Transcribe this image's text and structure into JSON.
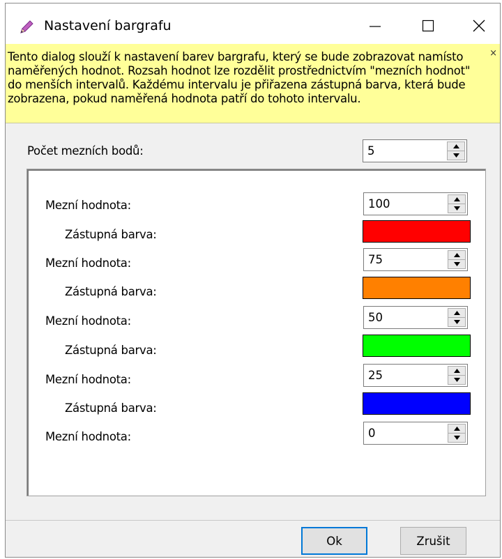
{
  "window": {
    "title": "Nastavení bargrafu",
    "icon": "pencil-icon",
    "controls": {
      "minimize": "—",
      "maximize": "☐",
      "close": "✕"
    }
  },
  "info": {
    "lines": [
      "Tento dialog slouží k nastavení barev bargrafu, který se bude zobrazovat namísto",
      "naměřených hodnot. Rozsah hodnot lze rozdělit prostřednictvím \"mezních hodnot\"",
      "do menších intervalů. Každému intervalu je přiřazena zástupná barva, která bude",
      "zobrazena, pokud naměřená hodnota patří do tohoto intervalu."
    ],
    "close": "×",
    "background": "#ffff99"
  },
  "count": {
    "label": "Počet mezních bodů:",
    "value": "5"
  },
  "limits": [
    {
      "label": "Mezní hodnota:",
      "value": "100",
      "color_label": "Zástupná barva:",
      "color": "#ff0000"
    },
    {
      "label": "Mezní hodnota:",
      "value": "75",
      "color_label": "Zástupná barva:",
      "color": "#ff8000"
    },
    {
      "label": "Mezní hodnota:",
      "value": "50",
      "color_label": "Zástupná barva:",
      "color": "#00ff00"
    },
    {
      "label": "Mezní hodnota:",
      "value": "25",
      "color_label": "Zástupná barva:",
      "color": "#0000ff"
    },
    {
      "label": "Mezní hodnota:",
      "value": "0"
    }
  ],
  "buttons": {
    "ok": "Ok",
    "cancel": "Zrušit"
  }
}
